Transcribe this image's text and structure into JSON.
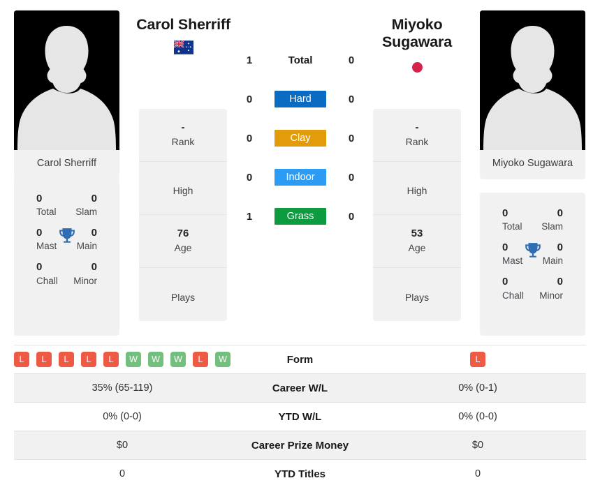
{
  "players": {
    "left": {
      "name": "Carol Sherriff",
      "photo_caption": "Carol Sherriff",
      "flag_icon": "flag-australia-icon",
      "flag_name": "Australia",
      "titles": {
        "total_value": "0",
        "total_label": "Total",
        "slam_value": "0",
        "slam_label": "Slam",
        "mast_value": "0",
        "mast_label": "Mast",
        "main_value": "0",
        "main_label": "Main",
        "chall_value": "0",
        "chall_label": "Chall",
        "minor_value": "0",
        "minor_label": "Minor",
        "trophy_icon": "trophy-icon"
      },
      "info": [
        {
          "value": "-",
          "label": "Rank"
        },
        {
          "value": "",
          "label": "High"
        },
        {
          "value": "76",
          "label": "Age"
        },
        {
          "value": "",
          "label": "Plays"
        }
      ]
    },
    "right": {
      "name": "Miyoko Sugawara",
      "photo_caption": "Miyoko Sugawara",
      "flag_icon": "flag-japan-icon",
      "flag_name": "Japan",
      "titles": {
        "total_value": "0",
        "total_label": "Total",
        "slam_value": "0",
        "slam_label": "Slam",
        "mast_value": "0",
        "mast_label": "Mast",
        "main_value": "0",
        "main_label": "Main",
        "chall_value": "0",
        "chall_label": "Chall",
        "minor_value": "0",
        "minor_label": "Minor",
        "trophy_icon": "trophy-icon"
      },
      "info": [
        {
          "value": "-",
          "label": "Rank"
        },
        {
          "value": "",
          "label": "High"
        },
        {
          "value": "53",
          "label": "Age"
        },
        {
          "value": "",
          "label": "Plays"
        }
      ]
    }
  },
  "head_to_head": [
    {
      "label": "Total",
      "left": "1",
      "right": "0",
      "type": "text",
      "color": ""
    },
    {
      "label": "Hard",
      "left": "0",
      "right": "0",
      "type": "badge",
      "color": "#0a6bc2"
    },
    {
      "label": "Clay",
      "left": "0",
      "right": "0",
      "type": "badge",
      "color": "#e29b0b"
    },
    {
      "label": "Indoor",
      "left": "0",
      "right": "0",
      "type": "badge",
      "color": "#2b9bf4"
    },
    {
      "label": "Grass",
      "left": "1",
      "right": "0",
      "type": "badge",
      "color": "#0d9b3f"
    }
  ],
  "comparison_table": [
    {
      "label": "Form",
      "type": "form",
      "left_form": [
        "L",
        "L",
        "L",
        "L",
        "L",
        "W",
        "W",
        "W",
        "L",
        "W"
      ],
      "right_form": [
        "L"
      ]
    },
    {
      "label": "Career W/L",
      "type": "text",
      "left": "35% (65-119)",
      "right": "0% (0-1)"
    },
    {
      "label": "YTD W/L",
      "type": "text",
      "left": "0% (0-0)",
      "right": "0% (0-0)"
    },
    {
      "label": "Career Prize Money",
      "type": "text",
      "left": "$0",
      "right": "$0"
    },
    {
      "label": "YTD Titles",
      "type": "text",
      "left": "0",
      "right": "0"
    }
  ],
  "colors": {
    "win_badge": "#73bf7d",
    "loss_badge": "#ee5a43",
    "trophy": "#2e6db4",
    "panel_bg": "#f1f1f1"
  }
}
